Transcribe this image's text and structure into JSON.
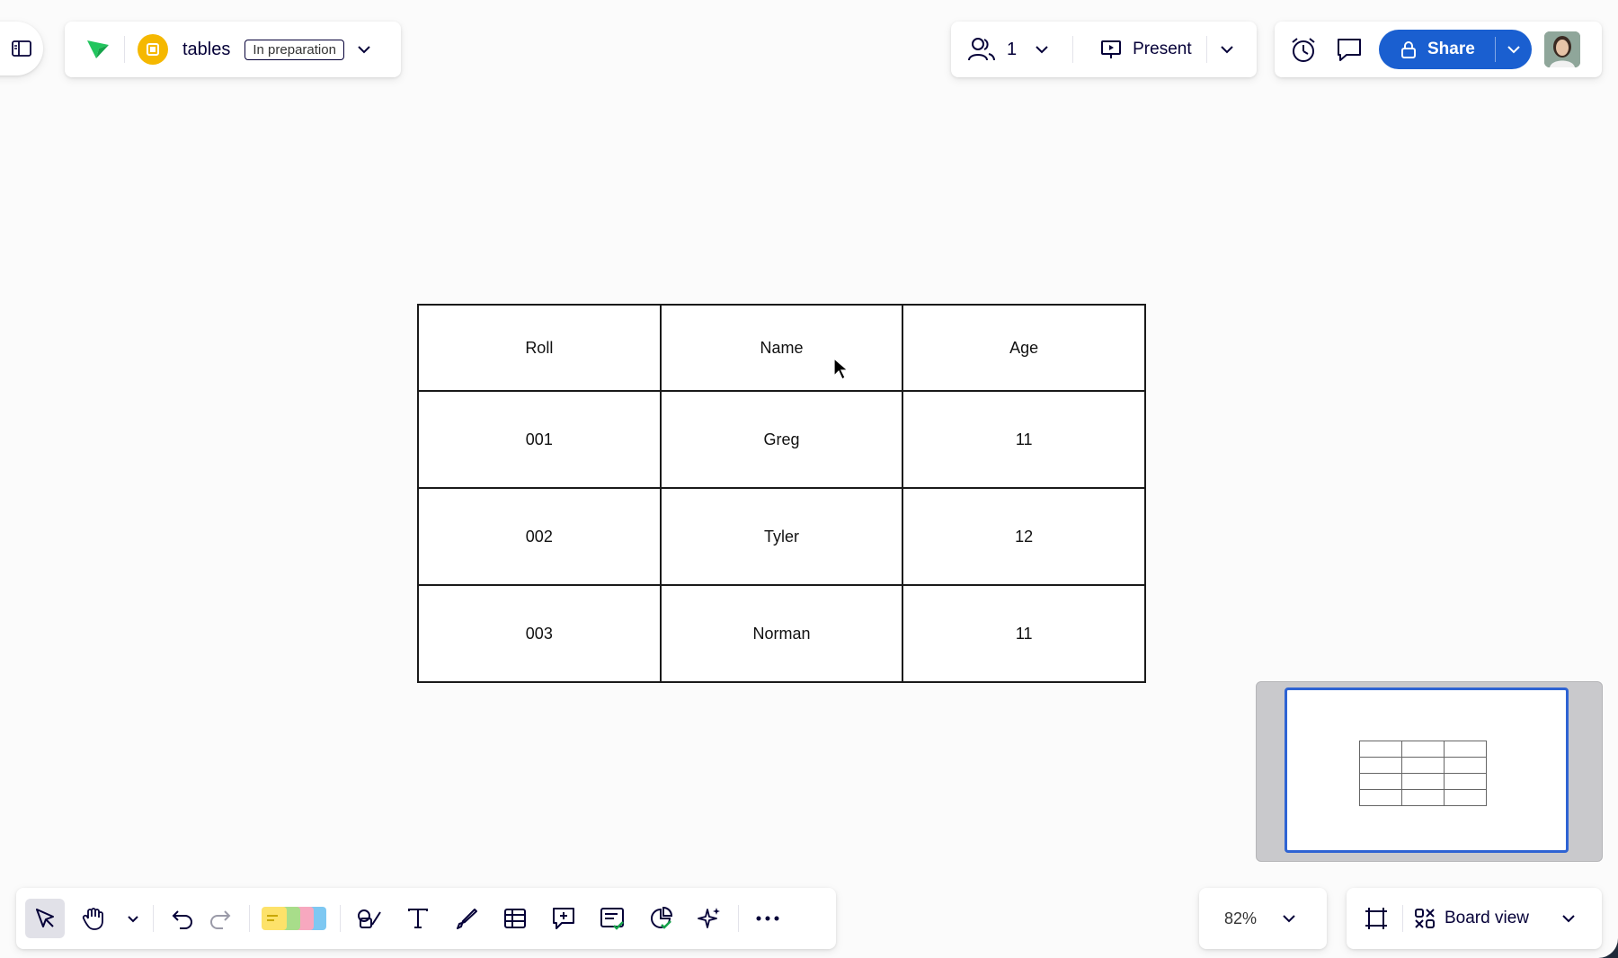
{
  "header": {
    "board_title": "tables",
    "status_badge": "In preparation",
    "collaborators_count": "1",
    "present_label": "Present",
    "share_label": "Share"
  },
  "table": {
    "headers": [
      "Roll",
      "Name",
      "Age"
    ],
    "rows": [
      [
        "001",
        "Greg",
        "11"
      ],
      [
        "002",
        "Tyler",
        "12"
      ],
      [
        "003",
        "Norman",
        "11"
      ]
    ]
  },
  "footer": {
    "zoom_level": "82%",
    "board_view_label": "Board view"
  },
  "colors": {
    "accent": "#2e63d3",
    "share_button": "#1a5fd0",
    "logo_green": "#22c55e",
    "board_icon": "#f5b800"
  },
  "icons": [
    "sidebar-toggle-icon",
    "logo-icon",
    "board-icon",
    "chevron-down-icon",
    "users-icon",
    "present-icon",
    "timer-icon",
    "comment-icon",
    "lock-icon",
    "cursor-icon",
    "hand-icon",
    "undo-icon",
    "redo-icon",
    "sticky-notes-icon",
    "shapes-icon",
    "text-icon",
    "pen-icon",
    "table-icon",
    "comment-add-icon",
    "card-icon",
    "apps-icon",
    "ai-sparkle-icon",
    "more-icon",
    "frame-icon",
    "board-view-icon"
  ]
}
